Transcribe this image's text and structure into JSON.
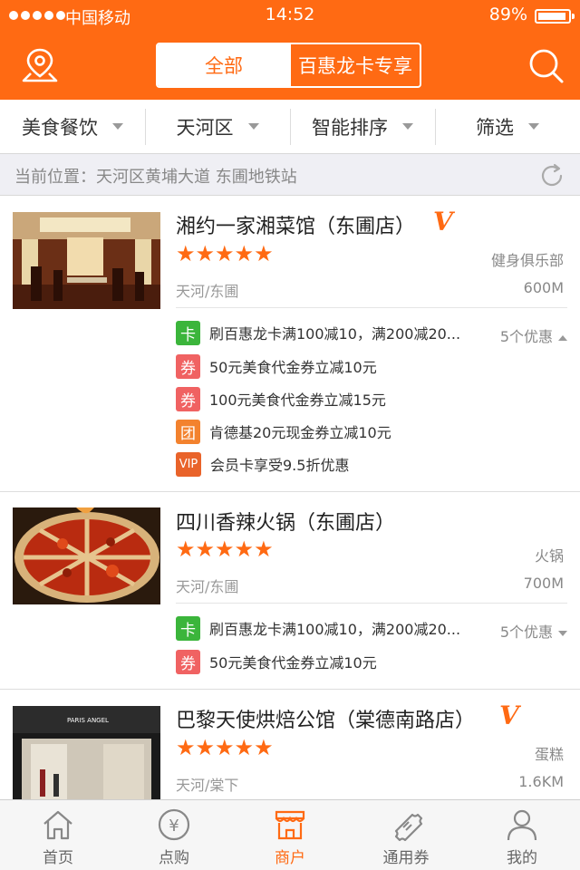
{
  "status_bar": {
    "carrier": "中国移动",
    "time": "14:52",
    "battery": "89%"
  },
  "header": {
    "segment_all": "全部",
    "segment_card": "百惠龙卡专享",
    "location_icon": "map-pin-icon",
    "search_icon": "search-icon"
  },
  "filters": [
    {
      "label": "美食餐饮"
    },
    {
      "label": "天河区"
    },
    {
      "label": "智能排序"
    },
    {
      "label": "筛选"
    }
  ],
  "location_bar": {
    "text": "当前位置：天河区黄埔大道 东圃地铁站",
    "refresh_icon": "refresh-icon"
  },
  "shops": [
    {
      "name": "湘约一家湘菜馆（东圃店）",
      "vip_badge": "V",
      "rating": 5,
      "stars_text": "★★★★★",
      "category": "健身俱乐部",
      "area": "天河/东圃",
      "distance": "600M",
      "more": "5个优惠",
      "deals": [
        {
          "tag": "卡",
          "text": "刷百惠龙卡满100减10，满200减20..."
        },
        {
          "tag": "券",
          "text": "50元美食代金券立减10元"
        },
        {
          "tag": "券",
          "text": "100元美食代金券立减15元"
        },
        {
          "tag": "团",
          "text": "肯德基20元现金券立减10元"
        },
        {
          "tag": "VIP",
          "text": "会员卡享受9.5折优惠"
        }
      ]
    },
    {
      "name": "四川香辣火锅（东圃店）",
      "rating": 5,
      "stars_text": "★★★★★",
      "category": "火锅",
      "area": "天河/东圃",
      "distance": "700M",
      "more": "5个优惠",
      "deals": [
        {
          "tag": "卡",
          "text": "刷百惠龙卡满100减10，满200减20..."
        },
        {
          "tag": "券",
          "text": "50元美食代金券立减10元"
        }
      ]
    },
    {
      "name": "巴黎天使烘焙公馆（棠德南路店）",
      "vip_badge": "V",
      "rating": 5,
      "stars_text": "★★★★★",
      "category": "蛋糕",
      "area": "天河/棠下",
      "distance": "1.6KM",
      "store_sign": "PARIS ANGEL"
    }
  ],
  "tabbar": [
    {
      "label": "首页",
      "icon": "home-icon"
    },
    {
      "label": "点购",
      "icon": "yen-coin-icon"
    },
    {
      "label": "商户",
      "icon": "storefront-icon",
      "active": true
    },
    {
      "label": "通用券",
      "icon": "ticket-icon"
    },
    {
      "label": "我的",
      "icon": "person-icon"
    }
  ],
  "colors": {
    "brand": "#ff6a13",
    "card_tag": "#3bb53b",
    "coupon_tag": "#f06262",
    "group_tag": "#f3822e",
    "vip_tag": "#e9632a"
  }
}
